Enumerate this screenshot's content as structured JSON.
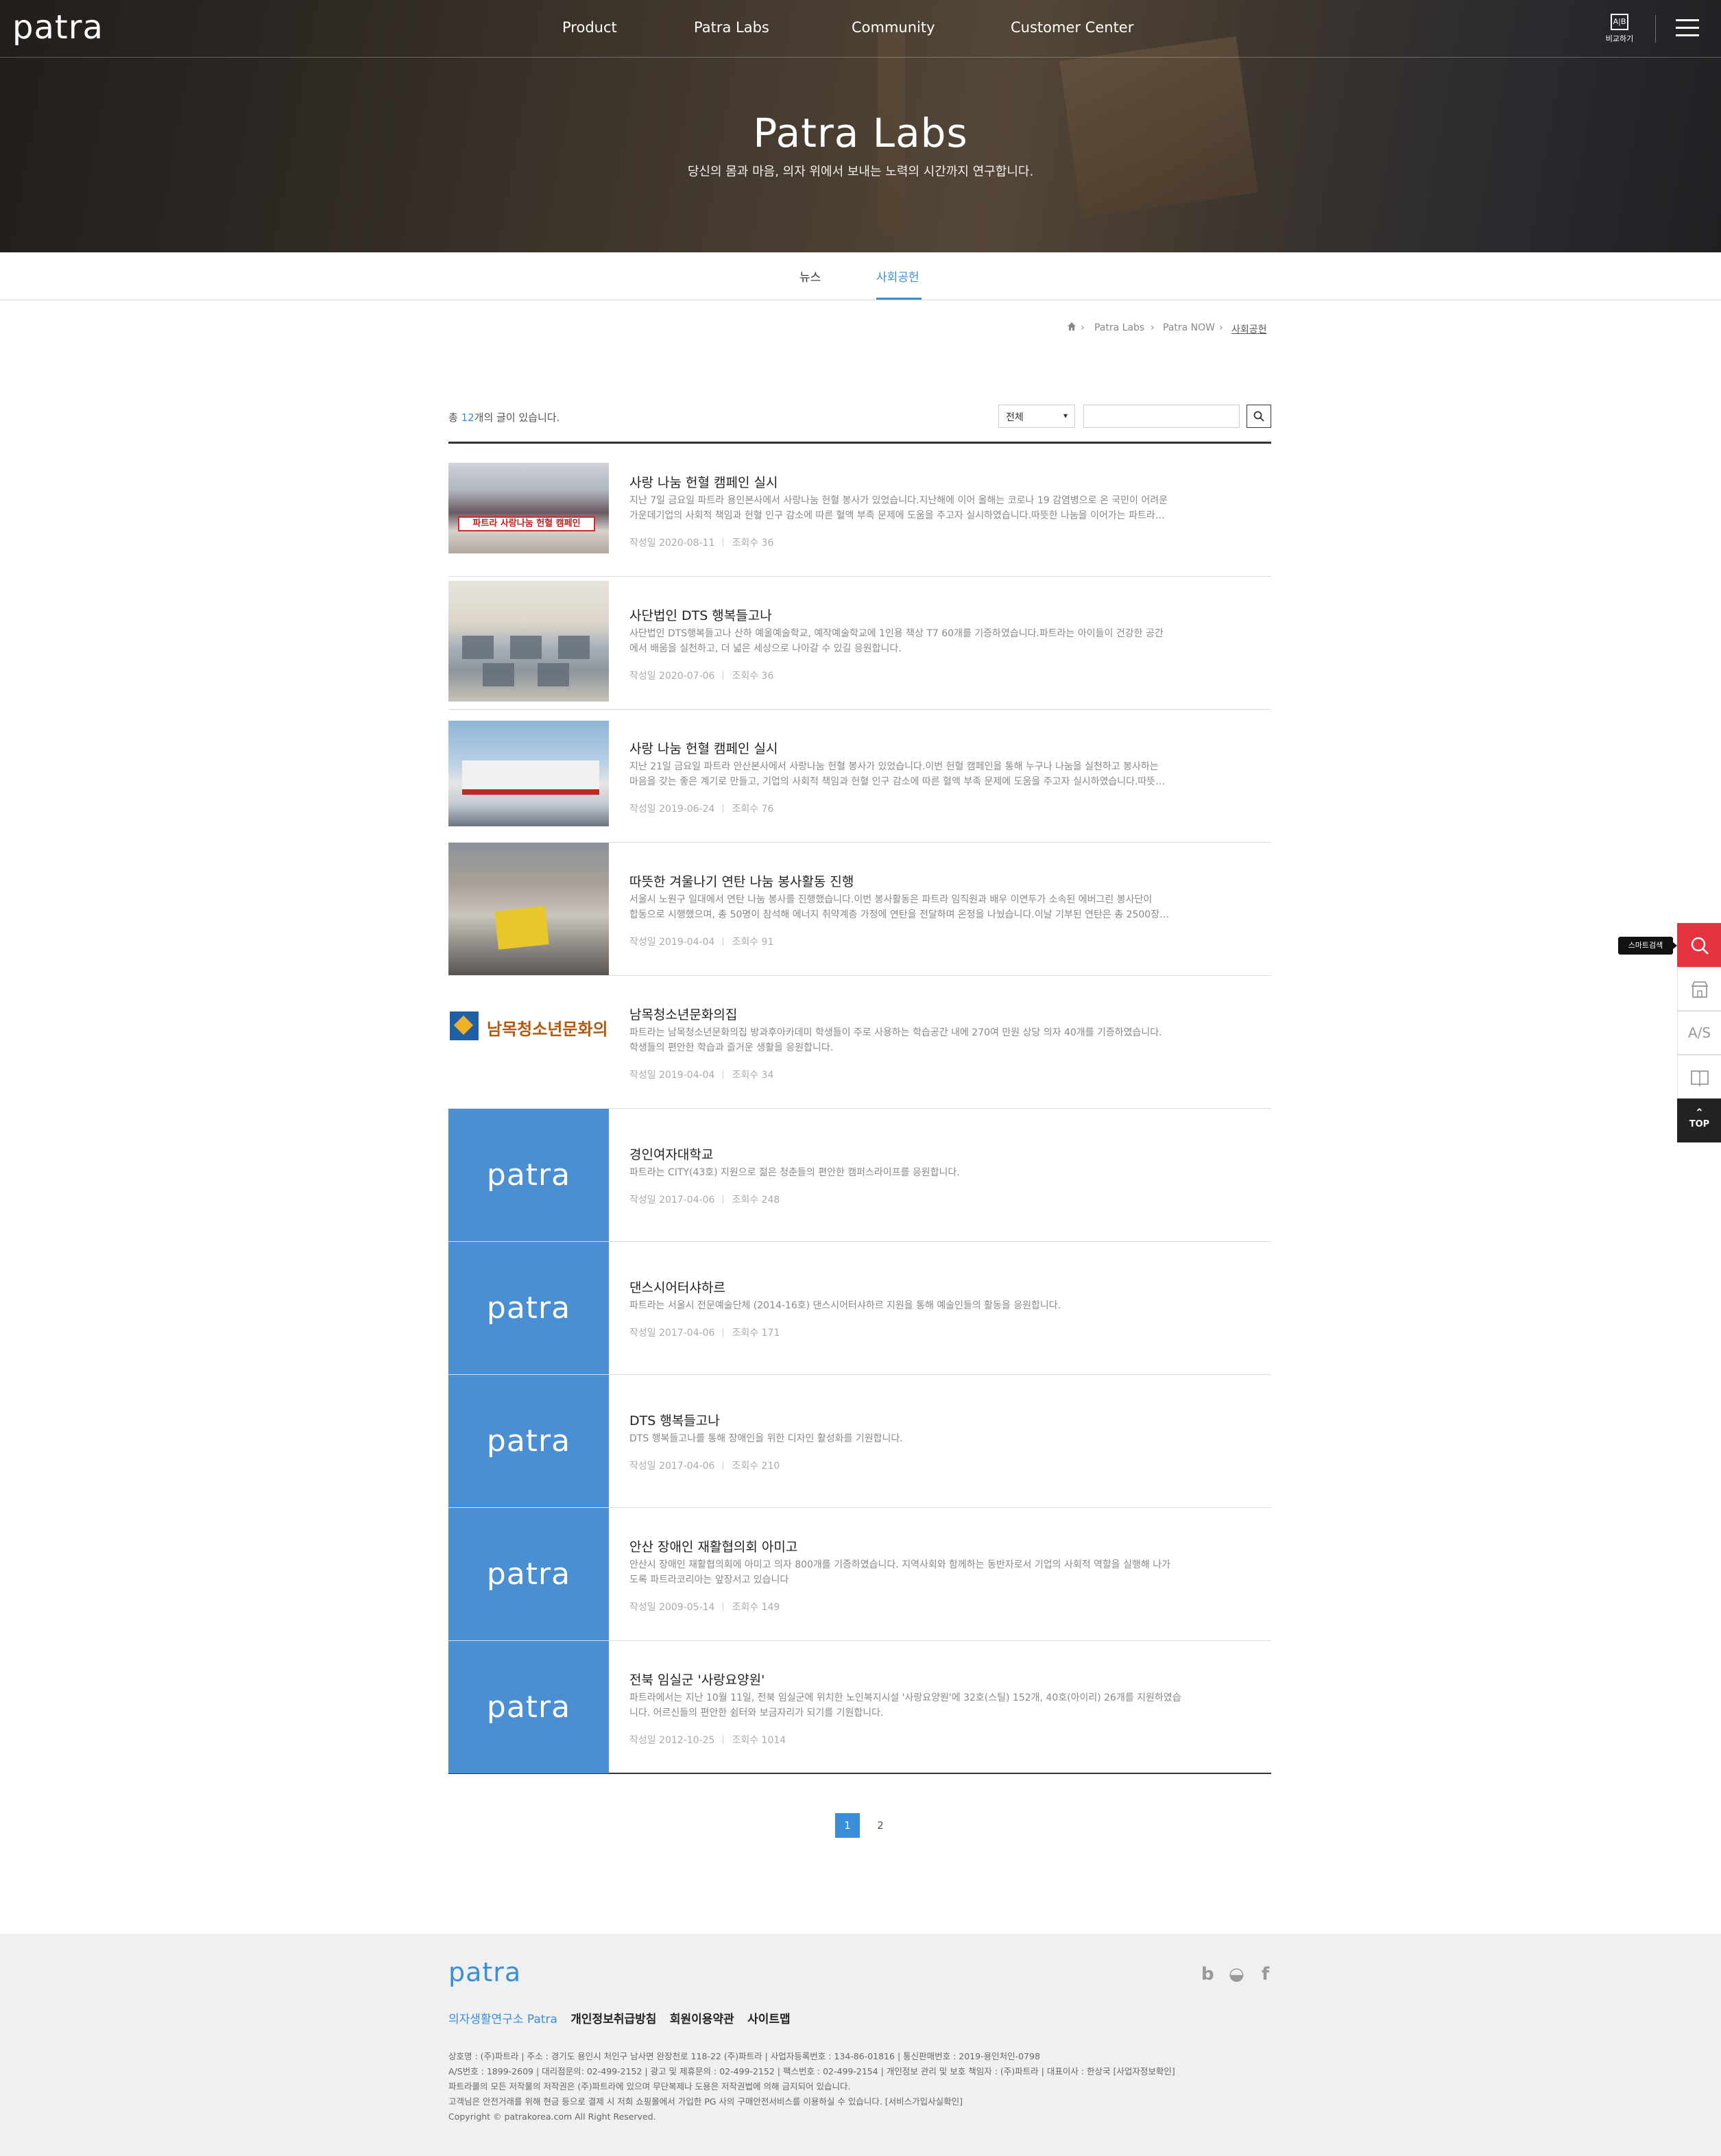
{
  "header": {
    "logo": "patra",
    "nav": [
      "Product",
      "Patra Labs",
      "Community",
      "Customer Center"
    ],
    "compare_icon_text": "A|B",
    "compare_label": "비교하기",
    "menu_icon": "hamburger-icon"
  },
  "hero": {
    "title": "Patra Labs",
    "subtitle": "당신의 몸과 마음, 의자 위에서 보내는 노력의 시간까지 연구합니다."
  },
  "tabs": [
    {
      "label": "뉴스",
      "active": false
    },
    {
      "label": "사회공헌",
      "active": true
    }
  ],
  "breadcrumb": [
    "Patra Labs",
    "Patra NOW",
    "사회공헌"
  ],
  "list_meta": {
    "total_prefix": "총 ",
    "total_count": "12",
    "total_suffix": "개의 글이 있습니다.",
    "filter_value": "전체",
    "search_value": ""
  },
  "accent_color": "#3a8ed7",
  "posts": [
    {
      "title": "사랑 나눔 헌혈 캠페인 실시",
      "desc": [
        "지난 7일 금요일 파트라 용인본사에서 사랑나눔 헌혈 봉사가 있었습니다.지난해에 이어 올해는 코로나 19 감염병으로 온 국민이 어려운",
        "가운데기업의 사회적 책임과 헌혈 인구 감소에 따른 혈액 부족 문제에 도움을 주고자 실시하였습니다.따뜻한 나눔을 이어가는 파트라…"
      ],
      "date": "작성일 2020-08-11",
      "views": "조회수 36",
      "thumb_text": "파트라 사랑나눔 헌혈 캠페인"
    },
    {
      "title": "사단법인 DTS 행복들고나",
      "desc": [
        " 사단법인 DTS행복들고나 산하 예울예술학교, 예작예술학교에 1인용 책상 T7 60개를 기증하였습니다.파트라는 아이들이 건강한 공간",
        "에서 배움을 실천하고, 더 넓은 세상으로 나아갈 수 있길 응원합니다."
      ],
      "date": "작성일 2020-07-06",
      "views": "조회수 36"
    },
    {
      "title": "사랑 나눔 헌혈 캠페인 실시",
      "desc": [
        " 지난 21일 금요일 파트라 안산본사에서 사랑나눔 헌혈 봉사가 있었습니다.이번 헌혈 캠페인을 통해 누구나 나눔을 실천하고 봉사하는",
        "마음을 갖는 좋은 계기로 만들고, 기업의 사회적 책임과 헌혈 인구 감소에 따른 혈액 부족 문제에 도움을 주고자 실시하였습니다.따뜻…"
      ],
      "date": "작성일 2019-06-24",
      "views": "조회수 76"
    },
    {
      "title": "따뜻한 겨울나기 연탄 나눔 봉사활동 진행",
      "desc": [
        " 서울시 노원구 일대에서 연탄 나눔 봉사를 진행했습니다.이번 봉사활동은 파트라 임직원과 배우 이연두가 소속된 에버그린 봉사단이",
        "합동으로 시행했으며, 총 50명이 참석해 에너지 취약계층 가정에 연탄을 전달하며 온정을 나눴습니다.이날 기부된 연탄은 총 2500장…"
      ],
      "date": "작성일 2019-04-04",
      "views": "조회수 91"
    },
    {
      "title": "남목청소년문화의집",
      "desc": [
        " 파트라는 남목청소년문화의집 방과후아카데미 학생들이 주로 사용하는 학습공간 내에 270여 만원 상당 의자 40개를 기증하였습니다.",
        "학생들의 편안한 학습과 즐거운 생활을 응원합니다."
      ],
      "date": "작성일 2019-04-04",
      "views": "조회수 34",
      "thumb_text": "남목청소년문화의집"
    },
    {
      "title": "경인여자대학교",
      "desc": [
        " 파트라는 CITY(43호) 지원으로 젊은 청춘들의 편안한 캠퍼스라이프를 응원합니다."
      ],
      "date": "작성일 2017-04-06",
      "views": "조회수 248",
      "thumb_text": "patra"
    },
    {
      "title": "댄스시어터샤하르",
      "desc": [
        "  파트라는 서울시 전문예술단체 (2014-16호) 댄스시어터샤하르 지원을 통해 예술인들의 활동을 응원합니다."
      ],
      "date": "작성일 2017-04-06",
      "views": "조회수 171",
      "thumb_text": "patra"
    },
    {
      "title": "DTS 행복들고나",
      "desc": [
        " DTS 행복들고나를 통해 장애인을 위한 디자인 활성화를 기원합니다."
      ],
      "date": "작성일 2017-04-06",
      "views": "조회수 210",
      "thumb_text": "patra"
    },
    {
      "title": "안산 장애인 재활협의회 아미고",
      "desc": [
        "안산시 장애인 재활협의회에 아미고 의자 800개를 기증하였습니다. 지역사회와 함께하는 동반자로서 기업의 사회적 역할을 실행해 나가",
        "도록 파트라코리아는 앞장서고 있습니다"
      ],
      "date": "작성일 2009-05-14",
      "views": "조회수 149",
      "thumb_text": "patra"
    },
    {
      "title": "전북 임실군 '사랑요양원'",
      "desc": [
        "파트라에서는 지난 10월 11일, 전북 임실군에 위치한 노인복지시설 '사랑요양원'에 32호(스틸) 152개, 40호(아이리) 26개를 지원하였습",
        "니다. 어르신들의 편안한 쉼터와 보금자리가 되기를 기원합니다."
      ],
      "date": "작성일 2012-10-25",
      "views": "조회수 1014",
      "thumb_text": "patra"
    }
  ],
  "pagination": [
    "1",
    "2"
  ],
  "quick_menu": {
    "tooltip": "스마트검색",
    "as_label": "A/S",
    "top_label": "TOP"
  },
  "footer": {
    "logo": "patra",
    "social": [
      "b",
      "◒",
      "f"
    ],
    "links": [
      "의자생활연구소 Patra",
      "개인정보취급방침",
      "회원이용약관",
      "사이트맵"
    ],
    "info": [
      "상호명 : (주)파트라   |   주소 : 경기도 용인시 처인구 남사면 완장천로 118-22 (주)파트라   |   사업자등록번호 : 134-86-01816   |   통신판매번호 : 2019-용인처인-0798",
      "A/S번호 : 1899-2609   |   대리점문의: 02-499-2152   |   광고 및 제휴문의 : 02-499-2152   |   팩스번호 : 02-499-2154   |   개인정보 관리 및 보호 책임자 : (주)파트라   |   대표이사 : 한상국 [사업자정보확인]",
      "파트라몰의 모든 저작물의 저작권은 (주)파트라에 있으며 무단복제나 도용은 저작권법에 의해 금지되어 있습니다.",
      "고객님은 안전거래를 위해 현금 등으로 결제 시 저희 쇼핑몰에서 가입한 PG 사의 구매안전서비스를 이용하실 수 있습니다. [서비스가입사실확인]",
      "Copyright © patrakorea.com All Right Reserved."
    ]
  }
}
